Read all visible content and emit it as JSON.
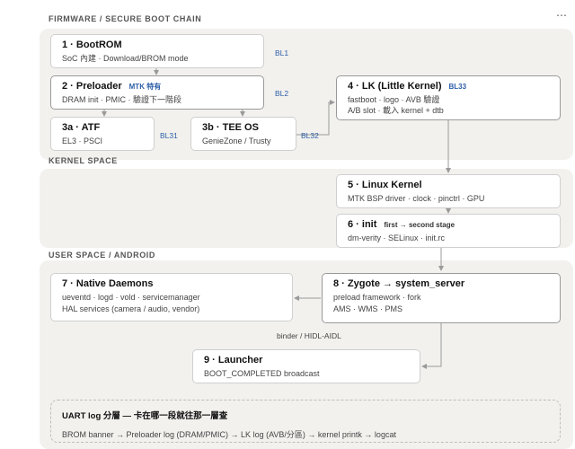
{
  "sections": {
    "firmware": "FIRMWARE / SECURE BOOT CHAIN",
    "kernel": "KERNEL SPACE",
    "user": "USER SPACE / ANDROID"
  },
  "menu_icon": "⋯",
  "nodes": {
    "bootrom": {
      "title": "1 · BootROM",
      "sub": "SoC 內建 · Download/BROM mode",
      "bl": "BL1"
    },
    "preloader": {
      "title": "2 · Preloader",
      "tag": "MTK 特有",
      "sub": "DRAM init · PMIC · 驗證下一階段",
      "bl": "BL2"
    },
    "atf": {
      "title": "3a · ATF",
      "sub": "EL3 · PSCI",
      "bl": "BL31"
    },
    "tee": {
      "title": "3b · TEE OS",
      "sub": "GenieZone / Trusty",
      "bl": "BL32"
    },
    "lk": {
      "title": "4 · LK (Little Kernel)",
      "tag": "BL33",
      "sub1": "fastboot · logo · AVB 驗證",
      "sub2": "A/B slot · 載入 kernel + dtb"
    },
    "kernel": {
      "title": "5 · Linux Kernel",
      "sub": "MTK BSP driver · clock · pinctrl · GPU"
    },
    "init": {
      "title": "6 · init",
      "tag": "first → second stage",
      "sub": "dm-verity · SELinux · init.rc"
    },
    "daemons": {
      "title": "7 · Native Daemons",
      "sub1": "ueventd · logd · vold · servicemanager",
      "sub2": "HAL services (camera / audio, vendor)"
    },
    "zygote": {
      "title": "8 · Zygote → system_server",
      "sub1": "preload framework · fork",
      "sub2": "AMS · WMS · PMS"
    },
    "launcher": {
      "title": "9 · Launcher",
      "sub": "BOOT_COMPLETED broadcast"
    }
  },
  "edge_labels": {
    "binder": "binder / HIDL-AIDL"
  },
  "legend": {
    "title": "UART log 分層 — 卡在哪一段就往那一層查",
    "text": "BROM banner → Preloader log (DRAM/PMIC) → LK log (AVB/分區) → kernel printk → logcat"
  },
  "colors": {
    "band": "#f2f1ee",
    "accent": "#2d5fa8",
    "border": "#cfcfcf",
    "edge": "#9a9a9a"
  }
}
